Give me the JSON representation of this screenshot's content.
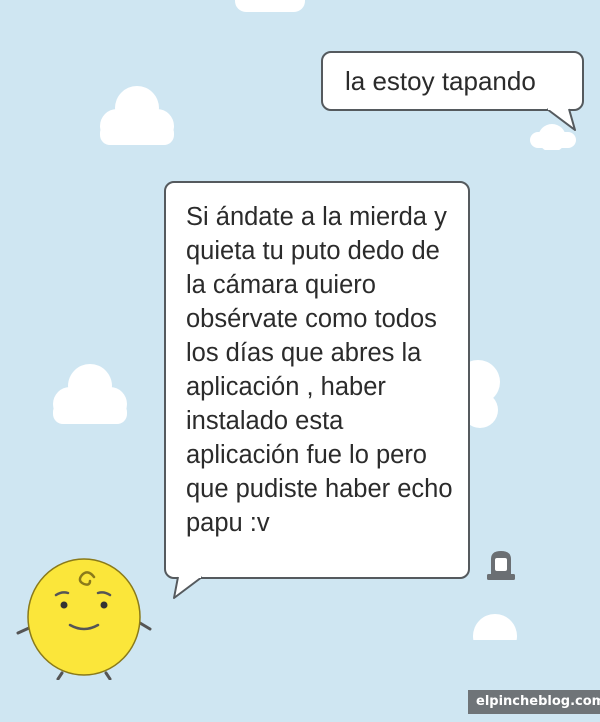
{
  "chat": {
    "messages": [
      {
        "sender": "user",
        "text": "la estoy tapando"
      },
      {
        "sender": "bot",
        "text": "Si ándate a la mierda y quieta tu puto dedo de la cámara quiero obsérvate como todos los días que abres la aplicación , haber instalado esta aplicación fue lo pero que pudiste haber echo papu :v"
      }
    ]
  },
  "icons": {
    "report": "siren-icon",
    "avatar": "simsimi-mascot-icon"
  },
  "watermark": {
    "text": "elpincheblog.com"
  },
  "colors": {
    "background": "#cfe6f2",
    "cloud": "#ffffff",
    "bubble_border": "#555a5e",
    "mascot": "#fbe63a"
  }
}
